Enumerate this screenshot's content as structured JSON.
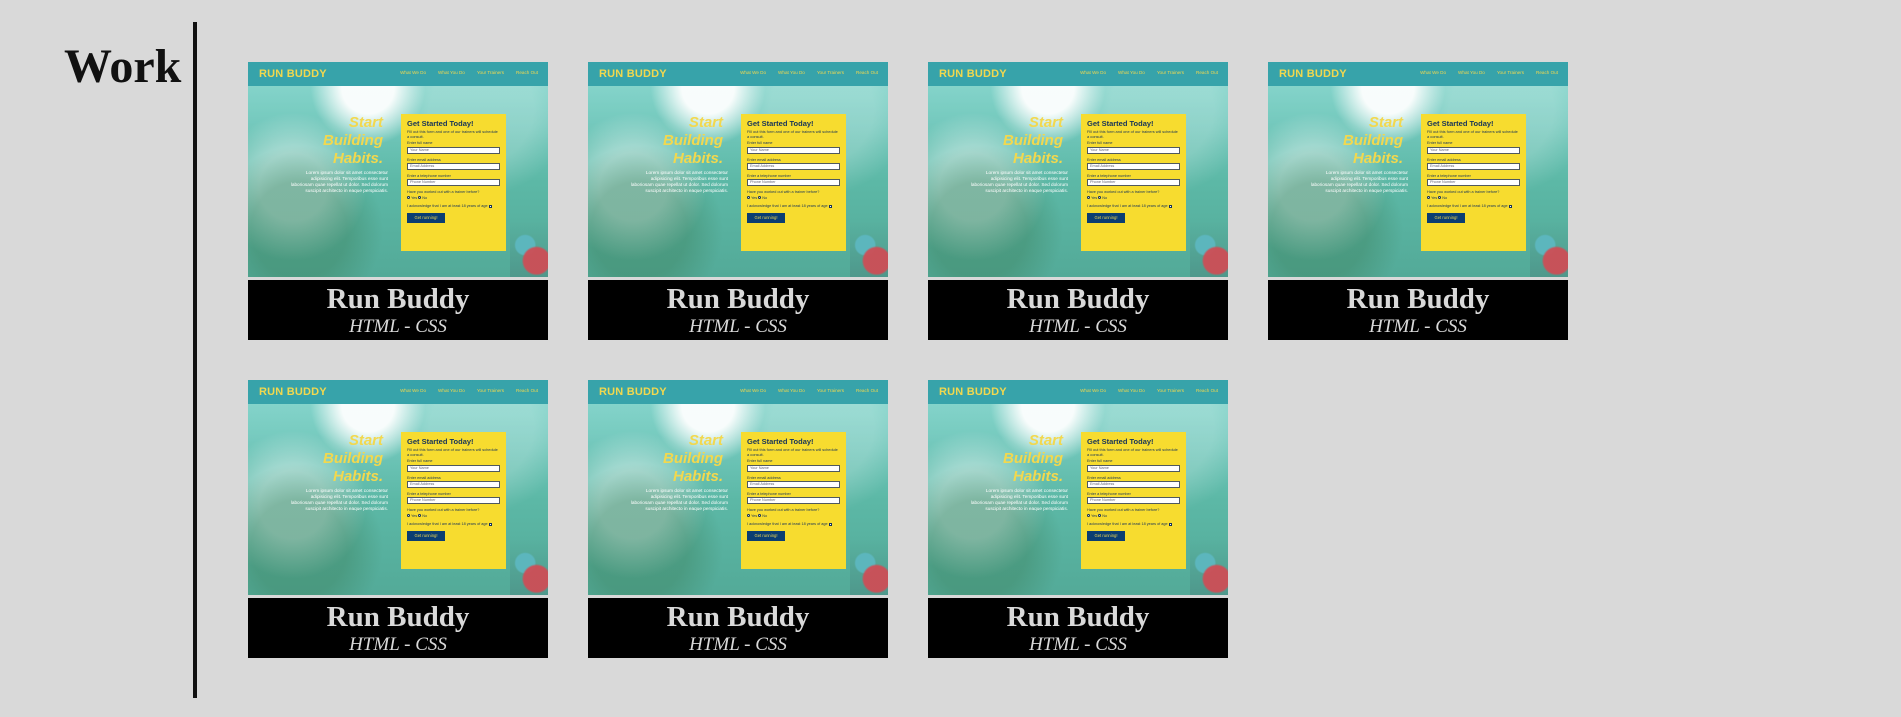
{
  "section": {
    "title": "Work"
  },
  "projects": [
    {
      "preview": {
        "brand": "RUN BUDDY",
        "nav": [
          "What We Do",
          "What You Do",
          "Your Trainers",
          "Reach Out"
        ],
        "hero_lines": [
          "Start",
          "Building",
          "Habits."
        ],
        "copy": "Lorem ipsum dolor sit amet consectetur adipisicing elit. Temporibus esse sunt laboriosam quae repellat ut dolor. Sed dolorum suscipit architecto in eaque perspiciatis.",
        "form": {
          "title": "Get Started Today!",
          "description": "Fill out this form and one of our trainers will schedule a consult.",
          "labels": [
            "Enter full name",
            "Enter email address",
            "Enter a telephone number",
            "Have you worked out with a trainer before?"
          ],
          "placeholders": [
            "Your Name",
            "Email Address",
            "Phone Number"
          ],
          "radio_options": [
            "Yes",
            "No"
          ],
          "checkbox_text": "I acknowledge that I am at least 18 years of age",
          "button": "Get running!"
        }
      },
      "caption": {
        "title": "Run Buddy",
        "subtitle": "HTML - CSS"
      }
    },
    {
      "preview": {
        "brand": "RUN BUDDY",
        "nav": [
          "What We Do",
          "What You Do",
          "Your Trainers",
          "Reach Out"
        ],
        "hero_lines": [
          "Start",
          "Building",
          "Habits."
        ],
        "copy": "Lorem ipsum dolor sit amet consectetur adipisicing elit. Temporibus esse sunt laboriosam quae repellat ut dolor. Sed dolorum suscipit architecto in eaque perspiciatis.",
        "form": {
          "title": "Get Started Today!",
          "description": "Fill out this form and one of our trainers will schedule a consult.",
          "labels": [
            "Enter full name",
            "Enter email address",
            "Enter a telephone number",
            "Have you worked out with a trainer before?"
          ],
          "placeholders": [
            "Your Name",
            "Email Address",
            "Phone Number"
          ],
          "radio_options": [
            "Yes",
            "No"
          ],
          "checkbox_text": "I acknowledge that I am at least 18 years of age",
          "button": "Get running!"
        }
      },
      "caption": {
        "title": "Run Buddy",
        "subtitle": "HTML - CSS"
      }
    },
    {
      "preview": {
        "brand": "RUN BUDDY",
        "nav": [
          "What We Do",
          "What You Do",
          "Your Trainers",
          "Reach Out"
        ],
        "hero_lines": [
          "Start",
          "Building",
          "Habits."
        ],
        "copy": "Lorem ipsum dolor sit amet consectetur adipisicing elit. Temporibus esse sunt laboriosam quae repellat ut dolor. Sed dolorum suscipit architecto in eaque perspiciatis.",
        "form": {
          "title": "Get Started Today!",
          "description": "Fill out this form and one of our trainers will schedule a consult.",
          "labels": [
            "Enter full name",
            "Enter email address",
            "Enter a telephone number",
            "Have you worked out with a trainer before?"
          ],
          "placeholders": [
            "Your Name",
            "Email Address",
            "Phone Number"
          ],
          "radio_options": [
            "Yes",
            "No"
          ],
          "checkbox_text": "I acknowledge that I am at least 18 years of age",
          "button": "Get running!"
        }
      },
      "caption": {
        "title": "Run Buddy",
        "subtitle": "HTML - CSS"
      }
    },
    {
      "preview": {
        "brand": "RUN BUDDY",
        "nav": [
          "What We Do",
          "What You Do",
          "Your Trainers",
          "Reach Out"
        ],
        "hero_lines": [
          "Start",
          "Building",
          "Habits."
        ],
        "copy": "Lorem ipsum dolor sit amet consectetur adipisicing elit. Temporibus esse sunt laboriosam quae repellat ut dolor. Sed dolorum suscipit architecto in eaque perspiciatis.",
        "form": {
          "title": "Get Started Today!",
          "description": "Fill out this form and one of our trainers will schedule a consult.",
          "labels": [
            "Enter full name",
            "Enter email address",
            "Enter a telephone number",
            "Have you worked out with a trainer before?"
          ],
          "placeholders": [
            "Your Name",
            "Email Address",
            "Phone Number"
          ],
          "radio_options": [
            "Yes",
            "No"
          ],
          "checkbox_text": "I acknowledge that I am at least 18 years of age",
          "button": "Get running!"
        }
      },
      "caption": {
        "title": "Run Buddy",
        "subtitle": "HTML - CSS"
      }
    },
    {
      "preview": {
        "brand": "RUN BUDDY",
        "nav": [
          "What We Do",
          "What You Do",
          "Your Trainers",
          "Reach Out"
        ],
        "hero_lines": [
          "Start",
          "Building",
          "Habits."
        ],
        "copy": "Lorem ipsum dolor sit amet consectetur adipisicing elit. Temporibus esse sunt laboriosam quae repellat ut dolor. Sed dolorum suscipit architecto in eaque perspiciatis.",
        "form": {
          "title": "Get Started Today!",
          "description": "Fill out this form and one of our trainers will schedule a consult.",
          "labels": [
            "Enter full name",
            "Enter email address",
            "Enter a telephone number",
            "Have you worked out with a trainer before?"
          ],
          "placeholders": [
            "Your Name",
            "Email Address",
            "Phone Number"
          ],
          "radio_options": [
            "Yes",
            "No"
          ],
          "checkbox_text": "I acknowledge that I am at least 18 years of age",
          "button": "Get running!"
        }
      },
      "caption": {
        "title": "Run Buddy",
        "subtitle": "HTML - CSS"
      }
    },
    {
      "preview": {
        "brand": "RUN BUDDY",
        "nav": [
          "What We Do",
          "What You Do",
          "Your Trainers",
          "Reach Out"
        ],
        "hero_lines": [
          "Start",
          "Building",
          "Habits."
        ],
        "copy": "Lorem ipsum dolor sit amet consectetur adipisicing elit. Temporibus esse sunt laboriosam quae repellat ut dolor. Sed dolorum suscipit architecto in eaque perspiciatis.",
        "form": {
          "title": "Get Started Today!",
          "description": "Fill out this form and one of our trainers will schedule a consult.",
          "labels": [
            "Enter full name",
            "Enter email address",
            "Enter a telephone number",
            "Have you worked out with a trainer before?"
          ],
          "placeholders": [
            "Your Name",
            "Email Address",
            "Phone Number"
          ],
          "radio_options": [
            "Yes",
            "No"
          ],
          "checkbox_text": "I acknowledge that I am at least 18 years of age",
          "button": "Get running!"
        }
      },
      "caption": {
        "title": "Run Buddy",
        "subtitle": "HTML - CSS"
      }
    },
    {
      "preview": {
        "brand": "RUN BUDDY",
        "nav": [
          "What We Do",
          "What You Do",
          "Your Trainers",
          "Reach Out"
        ],
        "hero_lines": [
          "Start",
          "Building",
          "Habits."
        ],
        "copy": "Lorem ipsum dolor sit amet consectetur adipisicing elit. Temporibus esse sunt laboriosam quae repellat ut dolor. Sed dolorum suscipit architecto in eaque perspiciatis.",
        "form": {
          "title": "Get Started Today!",
          "description": "Fill out this form and one of our trainers will schedule a consult.",
          "labels": [
            "Enter full name",
            "Enter email address",
            "Enter a telephone number",
            "Have you worked out with a trainer before?"
          ],
          "placeholders": [
            "Your Name",
            "Email Address",
            "Phone Number"
          ],
          "radio_options": [
            "Yes",
            "No"
          ],
          "checkbox_text": "I acknowledge that I am at least 18 years of age",
          "button": "Get running!"
        }
      },
      "caption": {
        "title": "Run Buddy",
        "subtitle": "HTML - CSS"
      }
    }
  ]
}
